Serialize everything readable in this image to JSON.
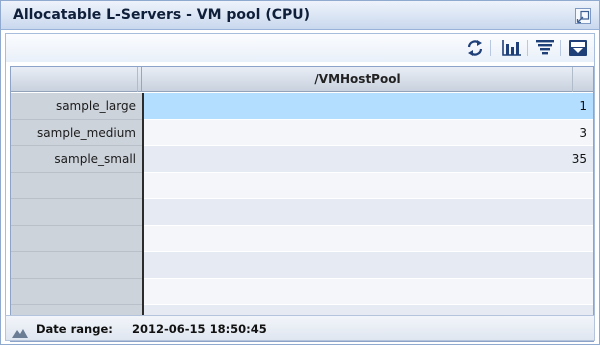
{
  "window": {
    "title": "Allocatable L-Servers - VM pool (CPU)"
  },
  "toolbar": {
    "icons": [
      "refresh-icon",
      "bar-chart-icon",
      "filter-icon",
      "export-icon"
    ]
  },
  "grid": {
    "column_header": "/VMHostPool",
    "rows": [
      {
        "label": "sample_large",
        "value": "1"
      },
      {
        "label": "sample_medium",
        "value": "3"
      },
      {
        "label": "sample_small",
        "value": "35"
      },
      {
        "label": "",
        "value": ""
      },
      {
        "label": "",
        "value": ""
      },
      {
        "label": "",
        "value": ""
      },
      {
        "label": "",
        "value": ""
      },
      {
        "label": "",
        "value": ""
      },
      {
        "label": "",
        "value": ""
      }
    ],
    "selected_row": 0
  },
  "status": {
    "label": "Date range:",
    "value": "2012-06-15 18:50:45"
  },
  "colors": {
    "title_gradient": "#c9d8ee",
    "row_header_bg": "#cdd3db",
    "selected_cell": "#b3deff",
    "odd_row": "#e5eaf3",
    "even_row": "#f4f6fa"
  }
}
